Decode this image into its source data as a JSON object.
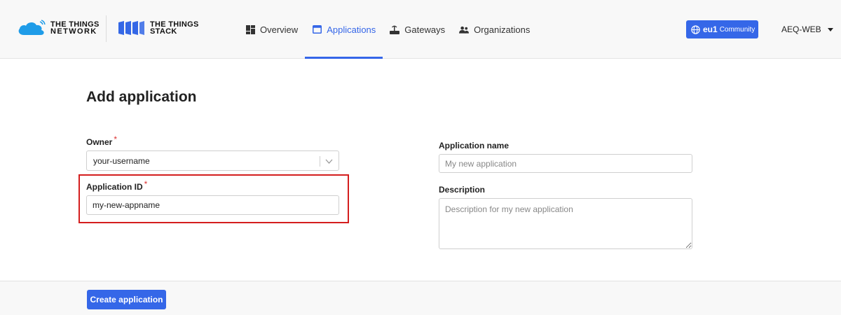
{
  "header": {
    "brand_ttn": {
      "line1": "THE THINGS",
      "line2": "NETWORK"
    },
    "brand_tts": {
      "line1": "THE THINGS",
      "line2": "STACK"
    },
    "nav": [
      {
        "label": "Overview",
        "icon": "overview-icon",
        "active": false
      },
      {
        "label": "Applications",
        "icon": "applications-icon",
        "active": true
      },
      {
        "label": "Gateways",
        "icon": "gateway-icon",
        "active": false
      },
      {
        "label": "Organizations",
        "icon": "organizations-icon",
        "active": false
      }
    ],
    "cluster": {
      "region": "eu1",
      "type": "Community",
      "icon": "globe-icon"
    },
    "user": {
      "name": "AEQ-WEB",
      "icon": "caret-down-icon"
    }
  },
  "form": {
    "title": "Add application",
    "owner": {
      "label": "Owner",
      "required_mark": "*",
      "value": "your-username"
    },
    "application_id": {
      "label": "Application ID",
      "required_mark": "*",
      "value": "my-new-appname"
    },
    "application_name": {
      "label": "Application name",
      "placeholder": "My new application"
    },
    "description": {
      "label": "Description",
      "placeholder": "Description for my new application"
    },
    "submit_label": "Create application"
  },
  "colors": {
    "accent": "#3567e8",
    "highlight": "#d41e1e",
    "required": "#dd3333",
    "header_bg": "#f8f8f8"
  }
}
